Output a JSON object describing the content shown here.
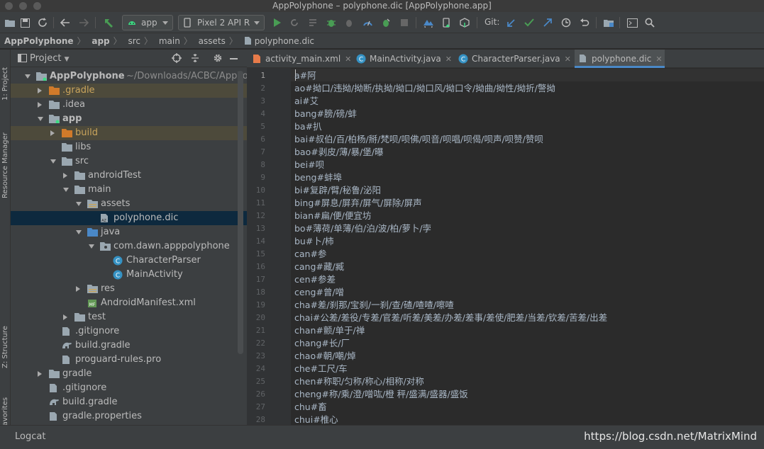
{
  "window": {
    "title": "AppPolyphone – polyphone.dic [AppPolyphone.app]"
  },
  "toolbar": {
    "run_config": "app",
    "device": "Pixel 2 API R",
    "git_label": "Git:"
  },
  "breadcrumb": [
    "AppPolyphone",
    "app",
    "src",
    "main",
    "assets",
    "polyphone.dic"
  ],
  "left_strip": {
    "project": "1: Project",
    "resource_manager": "Resource Manager",
    "structure": "Z: Structure",
    "favorites": "2: Favorites"
  },
  "project_panel": {
    "title": "Project",
    "items": [
      {
        "label": "AppPolyphone",
        "path": "~/Downloads/ACBC/AppPo",
        "indent": 0,
        "arrow": "open",
        "icon": "module-folder"
      },
      {
        "label": ".gradle",
        "indent": 1,
        "arrow": "closed",
        "icon": "folder-orange",
        "excluded": true,
        "color": "#c9a45c"
      },
      {
        "label": ".idea",
        "indent": 1,
        "arrow": "closed",
        "icon": "folder"
      },
      {
        "label": "app",
        "indent": 1,
        "arrow": "open",
        "icon": "module-folder",
        "bold": true
      },
      {
        "label": "build",
        "indent": 2,
        "arrow": "closed",
        "icon": "folder-orange",
        "excluded": true,
        "color": "#c9a45c"
      },
      {
        "label": "libs",
        "indent": 2,
        "arrow": "none",
        "icon": "folder"
      },
      {
        "label": "src",
        "indent": 2,
        "arrow": "open",
        "icon": "folder"
      },
      {
        "label": "androidTest",
        "indent": 3,
        "arrow": "closed",
        "icon": "folder"
      },
      {
        "label": "main",
        "indent": 3,
        "arrow": "open",
        "icon": "folder"
      },
      {
        "label": "assets",
        "indent": 4,
        "arrow": "open",
        "icon": "folder-res"
      },
      {
        "label": "polyphone.dic",
        "indent": 5,
        "arrow": "none",
        "icon": "file-dic",
        "selected": true
      },
      {
        "label": "java",
        "indent": 4,
        "arrow": "open",
        "icon": "folder-blue"
      },
      {
        "label": "com.dawn.apppolyphone",
        "indent": 5,
        "arrow": "open",
        "icon": "package"
      },
      {
        "label": "CharacterParser",
        "indent": 6,
        "arrow": "none",
        "icon": "class"
      },
      {
        "label": "MainActivity",
        "indent": 6,
        "arrow": "none",
        "icon": "class"
      },
      {
        "label": "res",
        "indent": 4,
        "arrow": "closed",
        "icon": "folder-res"
      },
      {
        "label": "AndroidManifest.xml",
        "indent": 4,
        "arrow": "none",
        "icon": "manifest"
      },
      {
        "label": "test",
        "indent": 3,
        "arrow": "closed",
        "icon": "folder"
      },
      {
        "label": ".gitignore",
        "indent": 2,
        "arrow": "none",
        "icon": "file"
      },
      {
        "label": "build.gradle",
        "indent": 2,
        "arrow": "none",
        "icon": "gradle"
      },
      {
        "label": "proguard-rules.pro",
        "indent": 2,
        "arrow": "none",
        "icon": "file"
      },
      {
        "label": "gradle",
        "indent": 1,
        "arrow": "closed",
        "icon": "folder"
      },
      {
        "label": ".gitignore",
        "indent": 1,
        "arrow": "none",
        "icon": "file"
      },
      {
        "label": "build.gradle",
        "indent": 1,
        "arrow": "none",
        "icon": "gradle"
      },
      {
        "label": "gradle.properties",
        "indent": 1,
        "arrow": "none",
        "icon": "file"
      }
    ]
  },
  "tabs": [
    {
      "label": "activity_main.xml",
      "icon": "xml",
      "active": false
    },
    {
      "label": "MainActivity.java",
      "icon": "class",
      "active": false
    },
    {
      "label": "CharacterParser.java",
      "icon": "class",
      "active": false
    },
    {
      "label": "polyphone.dic",
      "icon": "file-dic",
      "active": true
    }
  ],
  "editor": {
    "current_line": 1,
    "lines": [
      "a#阿",
      "ao#拗口/违拗/拗断/执拗/拗口/拗口风/拗口令/拗曲/拗性/拗折/警拗",
      "ai#艾",
      "bang#膀/磅/蚌",
      "ba#扒",
      "bai#叔伯/百/柏杨/掰/梵呗/呗佛/呗音/呗唱/呗偈/呗声/呗赞/赞呗",
      "bao#剥皮/薄/暴/堡/曝",
      "bei#呗",
      "beng#蚌埠",
      "bi#复辟/臂/秘鲁/泌阳",
      "bing#屏息/屏弃/屏气/屏除/屏声",
      "bian#扁/便/便宜坊",
      "bo#薄荷/单薄/伯/泊/波/柏/萝卜/孛",
      "bu#卜/柿",
      "can#参",
      "cang#藏/臧",
      "cen#参差",
      "ceng#曾/噌",
      "cha#差/刹那/宝刹/一刹/查/碴/喳喳/嚓喳",
      "chai#公差/差役/专差/官差/听差/美差/办差/差事/差使/肥差/当差/钦差/苦差/出差",
      "chan#颤/单于/禅",
      "chang#长/厂",
      "chao#朝/嘲/焯",
      "che#工尺/车",
      "chen#称职/匀称/称心/相称/对称",
      "cheng#称/乘/澄/噌吰/橙 秤/盛满/盛器/盛饭",
      "chu#畜",
      "chui#椎心"
    ]
  },
  "bottom": {
    "logcat": "Logcat",
    "watermark": "https://blog.csdn.net/MatrixMind"
  }
}
